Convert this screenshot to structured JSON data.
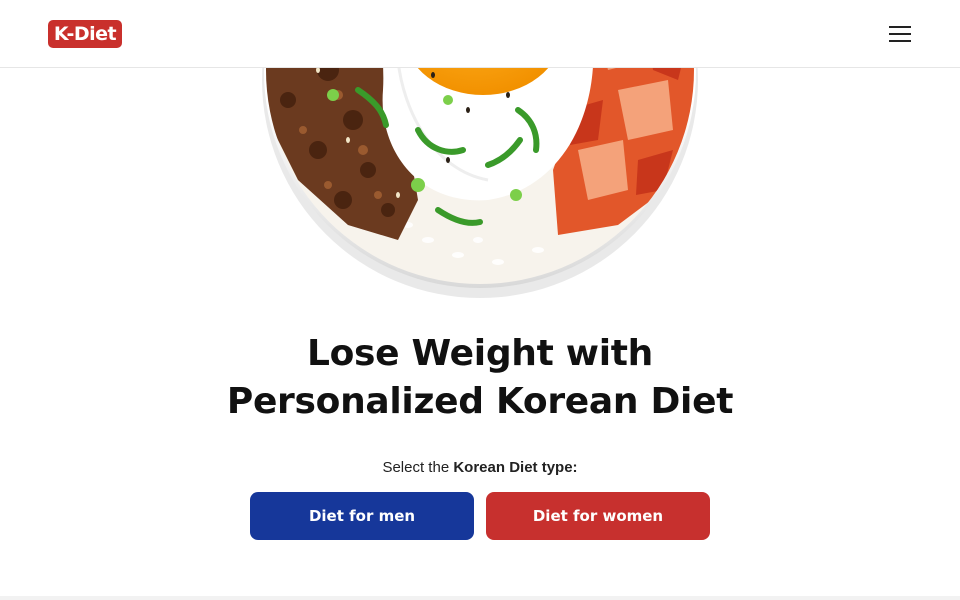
{
  "header": {
    "logo_text": "K-Diet",
    "menu_icon": "hamburger-menu-icon"
  },
  "hero": {
    "image_subject": "korean-rice-bowl-illustration"
  },
  "main": {
    "headline_line1": "Lose Weight with",
    "headline_line2": "Personalized Korean Diet",
    "select_prefix": "Select the ",
    "select_emphasis": "Korean Diet type:",
    "buttons": {
      "men_label": "Diet for men",
      "women_label": "Diet for women"
    }
  },
  "colors": {
    "brand_red": "#c9302c",
    "men_button": "#16379a",
    "women_button": "#c7302e"
  }
}
